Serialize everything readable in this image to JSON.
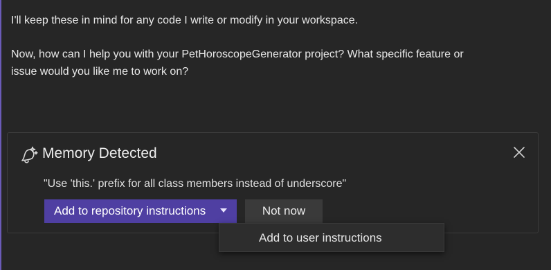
{
  "chat": {
    "lines": [
      "I'll keep these in mind for any code I write or modify in your workspace.",
      "Now, how can I help you with your PetHoroscopeGenerator project? What specific feature or",
      "issue would you like me to work on?"
    ]
  },
  "memory_card": {
    "icon": "bell-sparkle-icon",
    "title": "Memory Detected",
    "close_icon": "close-icon",
    "quote": "\"Use 'this.' prefix for all class members instead of underscore\"",
    "primary_button_label": "Add to repository instructions",
    "secondary_button_label": "Not now",
    "dropdown_items": [
      "Add to user instructions"
    ]
  },
  "colors": {
    "primary_button": "#4f3fa2",
    "accent_bar": "#6b5bb8",
    "panel_background": "#262626"
  }
}
